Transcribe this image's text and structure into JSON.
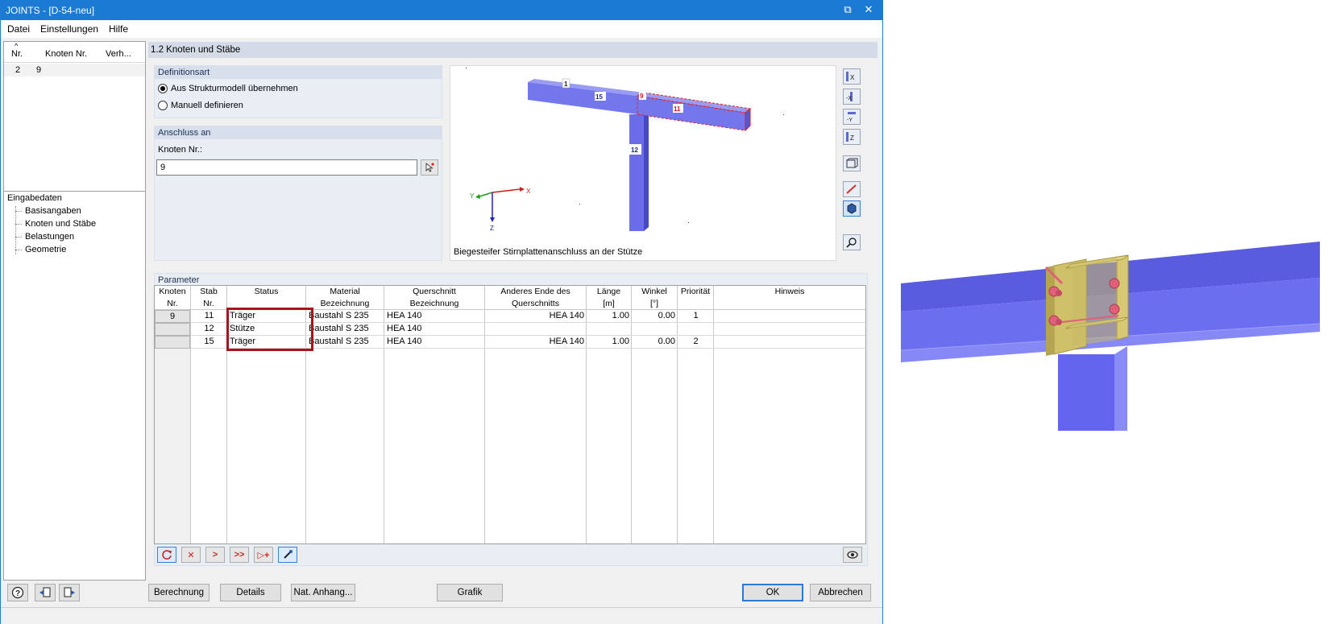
{
  "window": {
    "title": "JOINTS - [D-54-neu]",
    "controls": {
      "restore": "⧉",
      "close": "✕"
    }
  },
  "menu": [
    "Datei",
    "Einstellungen",
    "Hilfe"
  ],
  "left_panel": {
    "headers": [
      "Nr.",
      "Knoten Nr.",
      "Verh..."
    ],
    "rows": [
      {
        "nr": "2",
        "knoten": "9"
      }
    ],
    "tree": {
      "root": "Eingabedaten",
      "items": [
        "Basisangaben",
        "Knoten und Stäbe",
        "Belastungen",
        "Geometrie"
      ]
    }
  },
  "section_title": "1.2 Knoten und Stäbe",
  "definitionsart": {
    "title": "Definitionsart",
    "options": [
      "Aus Strukturmodell übernehmen",
      "Manuell definieren"
    ],
    "selected": 0
  },
  "anschluss": {
    "title": "Anschluss an",
    "label": "Knoten Nr.:",
    "value": "9"
  },
  "graphic": {
    "caption": "Biegesteifer Stirnplattenanschluss an der Stütze",
    "member_labels": [
      "1",
      "15",
      "9",
      "11",
      "12"
    ],
    "axes": [
      "X",
      "Y",
      "Z"
    ]
  },
  "view_toolbar": [
    "view-x-icon",
    "view-minus-x-icon",
    "view-minus-y-icon",
    "view-z-icon",
    "iso-view-icon",
    "member-select-icon",
    "render-solid-icon",
    "zoom-icon"
  ],
  "parameter": {
    "title": "Parameter",
    "headers": [
      [
        "Knoten",
        "Nr."
      ],
      [
        "Stab",
        "Nr."
      ],
      [
        "",
        "Status"
      ],
      [
        "Material",
        "Bezeichnung"
      ],
      [
        "Querschnitt",
        "Bezeichnung"
      ],
      [
        "Anderes Ende des",
        "Querschnitts"
      ],
      [
        "Länge",
        "[m]"
      ],
      [
        "Winkel",
        "[°]"
      ],
      [
        "",
        "Priorität"
      ],
      [
        "",
        "Hinweis"
      ]
    ],
    "rows": [
      {
        "knoten": "9",
        "stab": "11",
        "status": "Träger",
        "material": "Baustahl S 235",
        "querschnitt": "HEA 140",
        "anderes": "HEA 140",
        "laenge": "1.00",
        "winkel": "0.00",
        "prio": "1",
        "hinweis": ""
      },
      {
        "knoten": "",
        "stab": "12",
        "status": "Stütze",
        "material": "Baustahl S 235",
        "querschnitt": "HEA 140",
        "anderes": "",
        "laenge": "",
        "winkel": "",
        "prio": "",
        "hinweis": ""
      },
      {
        "knoten": "",
        "stab": "15",
        "status": "Träger",
        "material": "Baustahl S 235",
        "querschnitt": "HEA 140",
        "anderes": "HEA 140",
        "laenge": "1.00",
        "winkel": "0.00",
        "prio": "2",
        "hinweis": ""
      }
    ]
  },
  "grid_toolbar": {
    "btn2": "✕",
    "btn3": ">",
    "btn4": ">>",
    "btn5": "▷+"
  },
  "bottom_buttons": {
    "berechnung": "Berechnung",
    "details": "Details",
    "nat_anhang": "Nat. Anhang...",
    "grafik": "Grafik",
    "ok": "OK",
    "abbrechen": "Abbrechen"
  },
  "colors": {
    "member_blue": "#6a6ce8",
    "plate_yellow": "#d7c873",
    "bolt_red": "#e0607a",
    "highlight_red": "#a8141c",
    "title_blue": "#1a7ad4"
  }
}
